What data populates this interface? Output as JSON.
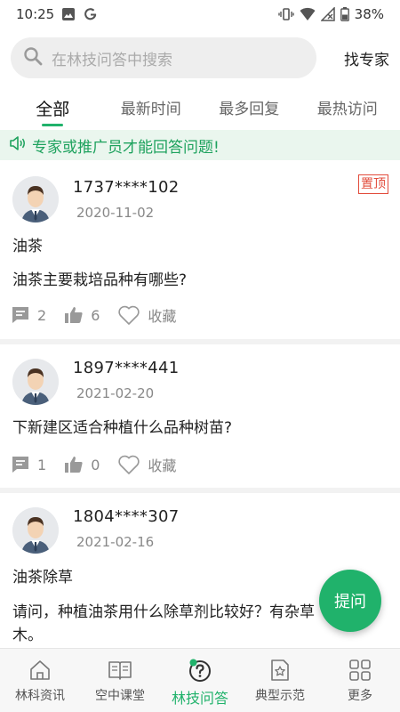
{
  "status_bar": {
    "time": "10:25",
    "left_icons": [
      "image-icon",
      "g-app-icon"
    ],
    "right_icons": [
      "vibrate-icon",
      "wifi-icon",
      "signal-icon",
      "battery-icon"
    ],
    "battery": "38%"
  },
  "search": {
    "placeholder": "在林技问答中搜索",
    "find_expert": "找专家"
  },
  "tabs": [
    {
      "label": "全部",
      "active": true
    },
    {
      "label": "最新时间",
      "active": false
    },
    {
      "label": "最多回复",
      "active": false
    },
    {
      "label": "最热访问",
      "active": false
    }
  ],
  "notice": {
    "text": "专家或推广员才能回答问题!",
    "icon": "megaphone-icon",
    "color": "#1ea25e"
  },
  "posts": [
    {
      "user": "1737****102",
      "date": "2020-11-02",
      "pinned": true,
      "pin_label": "置顶",
      "title": "油茶",
      "body": "油茶主要栽培品种有哪些?",
      "comments": "2",
      "likes": "6",
      "favorite_label": "收藏"
    },
    {
      "user": "1897****441",
      "date": "2021-02-20",
      "pinned": false,
      "title": "",
      "body": "下新建区适合种植什么品种树苗?",
      "comments": "1",
      "likes": "0",
      "favorite_label": "收藏"
    },
    {
      "user": "1804****307",
      "date": "2021-02-16",
      "pinned": false,
      "title": "油茶除草",
      "body": "请问，种植油茶用什么除草剂比较好？有杂草",
      "body_line2": "木。"
    }
  ],
  "fab": {
    "label": "提问"
  },
  "bottom_nav": [
    {
      "label": "林科资讯",
      "icon": "home-icon",
      "active": false
    },
    {
      "label": "空中课堂",
      "icon": "book-icon",
      "active": false
    },
    {
      "label": "林技问答",
      "icon": "question-icon",
      "active": true
    },
    {
      "label": "典型示范",
      "icon": "star-doc-icon",
      "active": false
    },
    {
      "label": "更多",
      "icon": "grid-icon",
      "active": false
    }
  ],
  "colors": {
    "accent": "#20b26b",
    "pin": "#e24b3b",
    "notice_bg": "#eaf6ee"
  }
}
